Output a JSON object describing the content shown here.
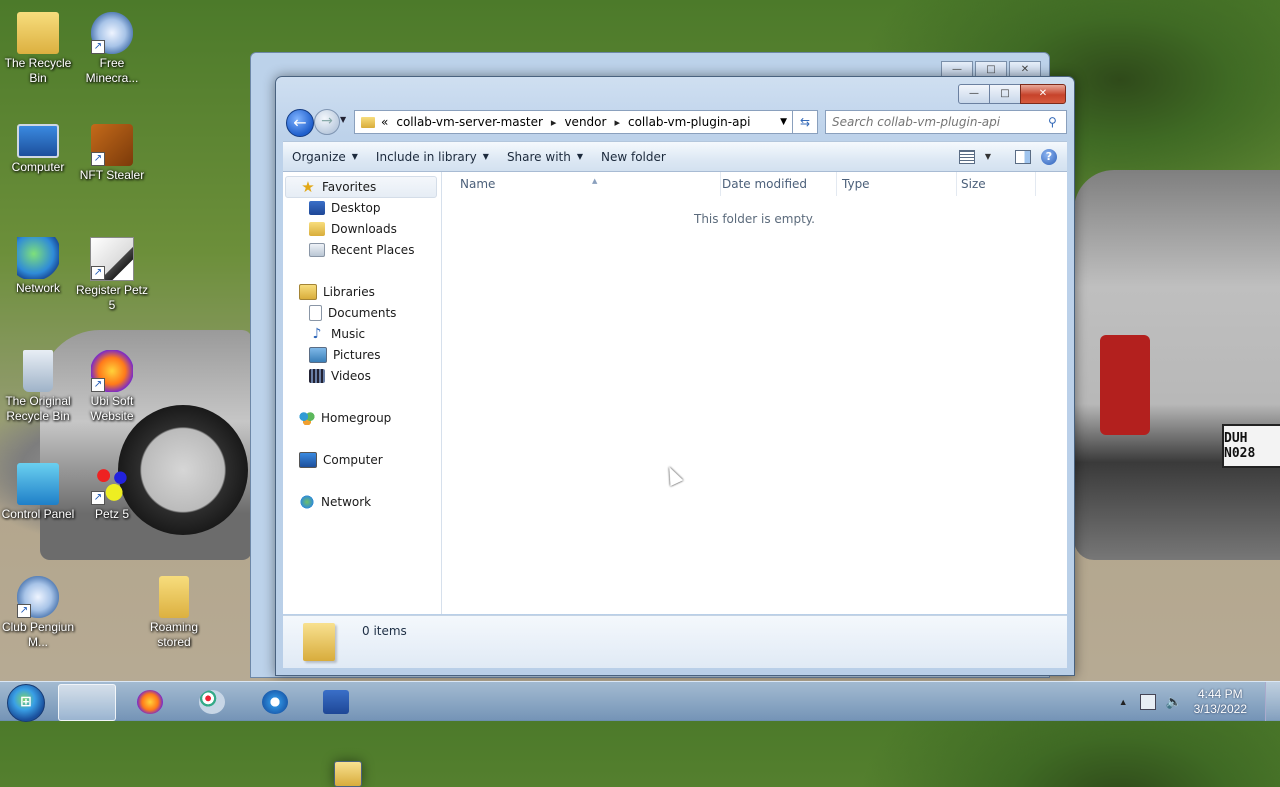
{
  "desktop": {
    "icons": [
      {
        "label": "The Recycle Bin",
        "icon": "folder-user-icon"
      },
      {
        "label": "Free Minecra...",
        "icon": "gear-shortcut-icon"
      },
      {
        "label": "Computer",
        "icon": "computer-icon"
      },
      {
        "label": "NFT Stealer",
        "icon": "nft-stealer-icon"
      },
      {
        "label": "Network",
        "icon": "network-icon"
      },
      {
        "label": "Register Petz 5",
        "icon": "register-petz-icon"
      },
      {
        "label": "The Original Recycle Bin",
        "icon": "recycle-bin-icon"
      },
      {
        "label": "Ubi Soft Website",
        "icon": "firefox-shortcut-icon"
      },
      {
        "label": "Control Panel",
        "icon": "control-panel-icon"
      },
      {
        "label": "Petz 5",
        "icon": "petz-icon"
      },
      {
        "label": "Club Pengiun M...",
        "icon": "gear-shortcut-icon"
      },
      {
        "label": "Roaming stored",
        "icon": "folder-icon"
      }
    ],
    "plate_text": "DUH N028"
  },
  "explorer": {
    "address": {
      "overflow": "«",
      "crumbs": [
        "collab-vm-server-master",
        "vendor",
        "collab-vm-plugin-api"
      ]
    },
    "search_placeholder": "Search collab-vm-plugin-api",
    "commands": {
      "organize": "Organize",
      "include": "Include in library",
      "share": "Share with",
      "new_folder": "New folder"
    },
    "nav": {
      "favorites": "Favorites",
      "desktop": "Desktop",
      "downloads": "Downloads",
      "recent": "Recent Places",
      "libraries": "Libraries",
      "documents": "Documents",
      "music": "Music",
      "pictures": "Pictures",
      "videos": "Videos",
      "homegroup": "Homegroup",
      "computer": "Computer",
      "network": "Network"
    },
    "columns": [
      "Name",
      "Date modified",
      "Type",
      "Size"
    ],
    "empty_message": "This folder is empty.",
    "item_count": "0 items"
  },
  "taskbar": {
    "start": "start-orb-icon",
    "time": "4:44 PM",
    "date": "3/13/2022"
  },
  "colors": {
    "accent": "#1f5fcc",
    "close": "#c7432b"
  }
}
